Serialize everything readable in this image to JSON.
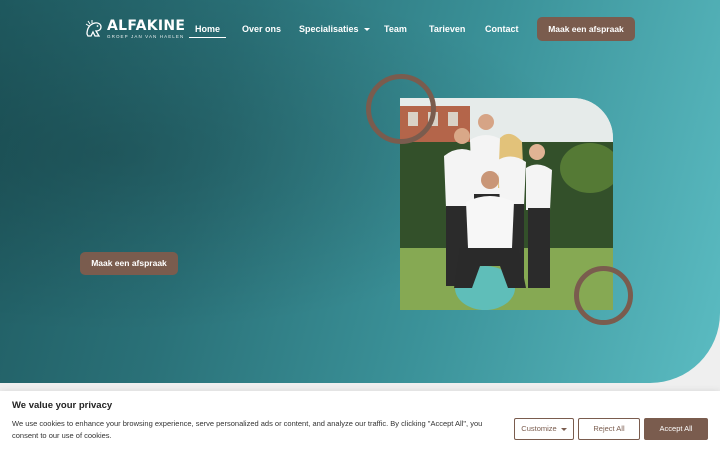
{
  "brand": {
    "name": "ALFAKINE",
    "tagline": "GROEP JAN VAN HAELEN",
    "icon": "logo-lion-icon"
  },
  "nav": {
    "items": [
      {
        "label": "Home",
        "active": true
      },
      {
        "label": "Over ons"
      },
      {
        "label": "Specialisaties",
        "has_dropdown": true
      },
      {
        "label": "Team"
      },
      {
        "label": "Tarieven"
      },
      {
        "label": "Contact"
      }
    ],
    "cta_label": "Maak een afspraak"
  },
  "hero": {
    "cta_label": "Maak een afspraak",
    "photo_alt": "team-photo",
    "colors": {
      "accent": "#7a5c4e",
      "gradient_start": "#1f5a60",
      "gradient_end": "#5bbcc2"
    }
  },
  "cookie_banner": {
    "title": "We value your privacy",
    "text": "We use cookies to enhance your browsing experience, serve personalized ads or content, and analyze our traffic. By clicking \"Accept All\", you consent to our use of cookies.",
    "buttons": {
      "customize": "Customize",
      "reject": "Reject All",
      "accept": "Accept All"
    }
  }
}
